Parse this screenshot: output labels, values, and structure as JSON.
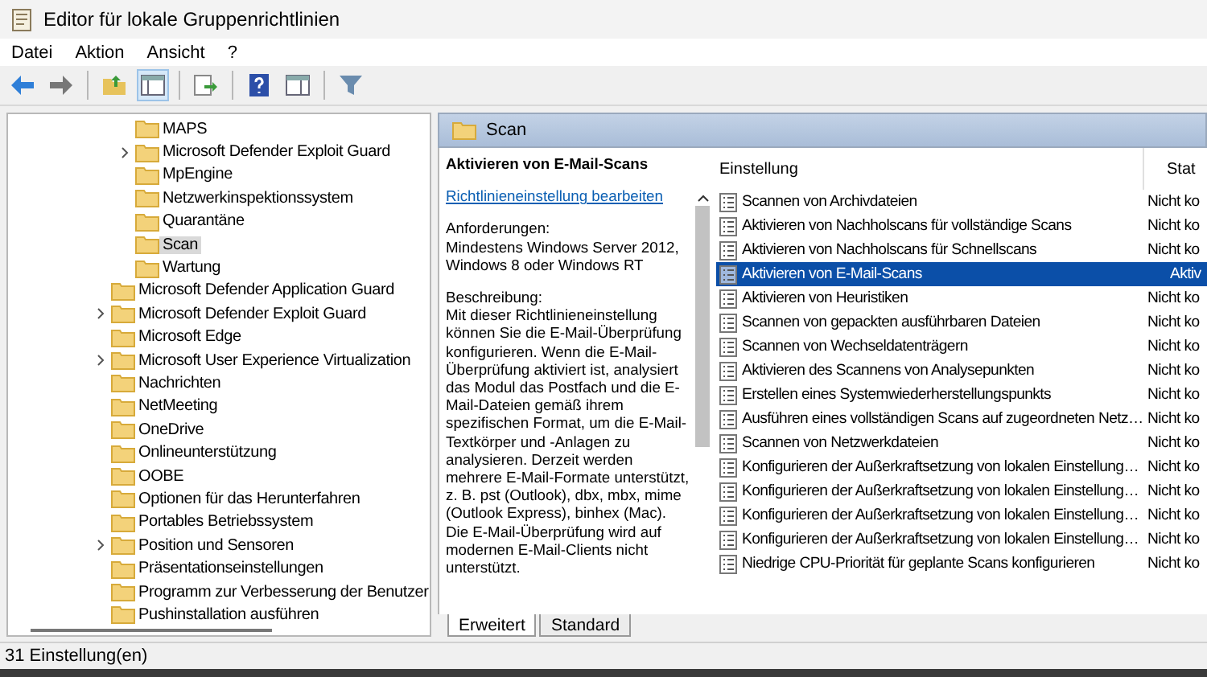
{
  "window": {
    "title": "Editor für lokale Gruppenrichtlinien"
  },
  "menu": [
    "Datei",
    "Aktion",
    "Ansicht",
    "?"
  ],
  "tree": {
    "items": [
      {
        "children": [
          {
            "label": "MAPS",
            "expandable": false,
            "selected": false
          },
          {
            "label": "Microsoft Defender Exploit Guard",
            "expandable": true,
            "selected": false
          },
          {
            "label": "MpEngine",
            "expandable": false,
            "selected": false
          },
          {
            "label": "Netzwerkinspektionssystem",
            "expandable": false,
            "selected": false
          },
          {
            "label": "Quarantäne",
            "expandable": false,
            "selected": false
          },
          {
            "label": "Scan",
            "expandable": false,
            "selected": true
          },
          {
            "label": "Wartung",
            "expandable": false,
            "selected": false
          }
        ]
      },
      {
        "label": "Microsoft Defender Application Guard",
        "expandable": false,
        "selected": false
      },
      {
        "label": "Microsoft Defender Exploit Guard",
        "expandable": true,
        "selected": false
      },
      {
        "label": "Microsoft Edge",
        "expandable": false,
        "selected": false
      },
      {
        "label": "Microsoft User Experience Virtualization",
        "expandable": true,
        "selected": false
      },
      {
        "label": "Nachrichten",
        "expandable": false,
        "selected": false
      },
      {
        "label": "NetMeeting",
        "expandable": false,
        "selected": false
      },
      {
        "label": "OneDrive",
        "expandable": false,
        "selected": false
      },
      {
        "label": "Onlineunterstützung",
        "expandable": false,
        "selected": false
      },
      {
        "label": "OOBE",
        "expandable": false,
        "selected": false
      },
      {
        "label": "Optionen für das Herunterfahren",
        "expandable": false,
        "selected": false
      },
      {
        "label": "Portables Betriebssystem",
        "expandable": false,
        "selected": false
      },
      {
        "label": "Position und Sensoren",
        "expandable": true,
        "selected": false
      },
      {
        "label": "Präsentationseinstellungen",
        "expandable": false,
        "selected": false
      },
      {
        "label": "Programm zur Verbesserung der Benutzer",
        "expandable": false,
        "selected": false
      },
      {
        "label": "Pushinstallation ausführen",
        "expandable": false,
        "selected": false
      }
    ]
  },
  "details": {
    "folder": "Scan",
    "heading": "Aktivieren von E-Mail-Scans",
    "link": "Richtlinieneinstellung bearbeiten",
    "paragraphs": [
      "Anforderungen:\nMindestens Windows Server 2012, Windows 8 oder Windows RT",
      "Beschreibung:\nMit dieser Richtlinieneinstellung können Sie die E-Mail-Überprüfung konfigurieren. Wenn die E-Mail-Überprüfung aktiviert ist, analysiert das Modul das Postfach und die E-Mail-Dateien gemäß ihrem spezifischen Format, um die E-Mail-Textkörper und -Anlagen zu analysieren. Derzeit werden mehrere E-Mail-Formate unterstützt, z. B. pst (Outlook), dbx, mbx, mime (Outlook Express), binhex (Mac). Die E-Mail-Überprüfung wird auf modernen E-Mail-Clients nicht unterstützt."
    ]
  },
  "table": {
    "columns": [
      "Einstellung",
      "Stat"
    ],
    "rows": [
      {
        "name": "Scannen von Archivdateien",
        "status": "Nicht ko",
        "selected": false
      },
      {
        "name": "Aktivieren von Nachholscans für vollständige Scans",
        "status": "Nicht ko",
        "selected": false
      },
      {
        "name": "Aktivieren von Nachholscans für Schnellscans",
        "status": "Nicht ko",
        "selected": false
      },
      {
        "name": "Aktivieren von E-Mail-Scans",
        "status": "Aktiv",
        "selected": true
      },
      {
        "name": "Aktivieren von Heuristiken",
        "status": "Nicht ko",
        "selected": false
      },
      {
        "name": "Scannen von gepackten ausführbaren Dateien",
        "status": "Nicht ko",
        "selected": false
      },
      {
        "name": "Scannen von Wechseldatenträgern",
        "status": "Nicht ko",
        "selected": false
      },
      {
        "name": "Aktivieren des Scannens von Analysepunkten",
        "status": "Nicht ko",
        "selected": false
      },
      {
        "name": "Erstellen eines Systemwiederherstellungspunkts",
        "status": "Nicht ko",
        "selected": false
      },
      {
        "name": "Ausführen eines vollständigen Scans auf zugeordneten Netz…",
        "status": "Nicht ko",
        "selected": false
      },
      {
        "name": "Scannen von Netzwerkdateien",
        "status": "Nicht ko",
        "selected": false
      },
      {
        "name": "Konfigurieren der Außerkraftsetzung von lokalen Einstellung…",
        "status": "Nicht ko",
        "selected": false
      },
      {
        "name": "Konfigurieren der Außerkraftsetzung von lokalen Einstellung…",
        "status": "Nicht ko",
        "selected": false
      },
      {
        "name": "Konfigurieren der Außerkraftsetzung von lokalen Einstellung…",
        "status": "Nicht ko",
        "selected": false
      },
      {
        "name": "Konfigurieren der Außerkraftsetzung von lokalen Einstellung…",
        "status": "Nicht ko",
        "selected": false
      },
      {
        "name": "Niedrige CPU-Priorität für geplante Scans konfigurieren",
        "status": "Nicht ko",
        "selected": false
      }
    ]
  },
  "view_tabs": [
    {
      "label": "Erweitert",
      "selected": true
    },
    {
      "label": "Standard",
      "selected": false
    }
  ],
  "status_bar": "31 Einstellung(en)"
}
